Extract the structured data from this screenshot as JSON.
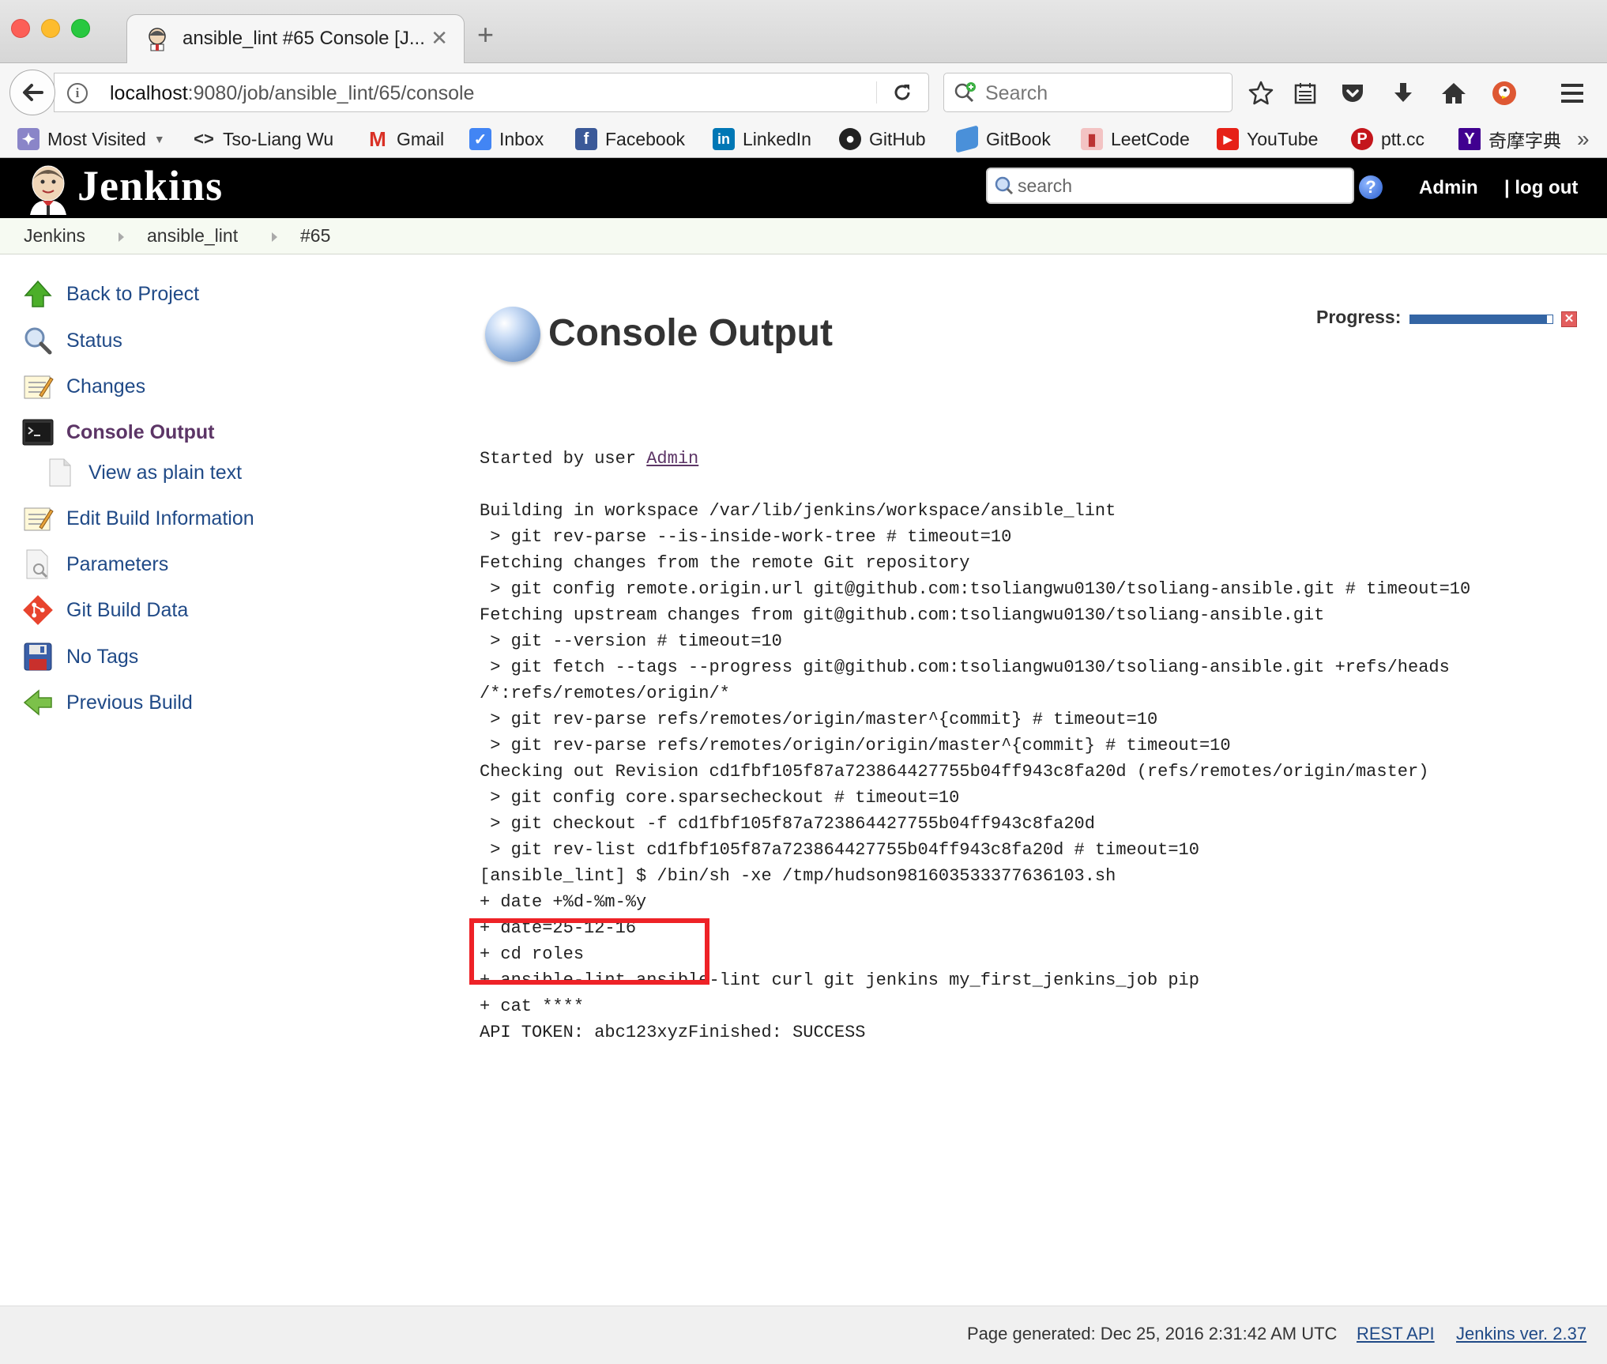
{
  "browser": {
    "tab_title": "ansible_lint #65 Console [J...",
    "new_tab": "+",
    "url_host": "localhost",
    "url_rest": ":9080/job/ansible_lint/65/console",
    "search_placeholder": "Search",
    "bookmarks": [
      {
        "label": "Most Visited",
        "icon": "most-visited-icon"
      },
      {
        "label": "Tso-Liang Wu",
        "icon": "code-icon"
      },
      {
        "label": "Gmail",
        "icon": "gmail-icon"
      },
      {
        "label": "Inbox",
        "icon": "inbox-icon"
      },
      {
        "label": "Facebook",
        "icon": "facebook-icon"
      },
      {
        "label": "LinkedIn",
        "icon": "linkedin-icon"
      },
      {
        "label": "GitHub",
        "icon": "github-icon"
      },
      {
        "label": "GitBook",
        "icon": "gitbook-icon"
      },
      {
        "label": "LeetCode",
        "icon": "leetcode-icon"
      },
      {
        "label": "YouTube",
        "icon": "youtube-icon"
      },
      {
        "label": "ptt.cc",
        "icon": "ptt-icon"
      },
      {
        "label": "奇摩字典",
        "icon": "yahoo-icon"
      }
    ],
    "more": "»"
  },
  "jenkins": {
    "logo": "Jenkins",
    "search_placeholder": "search",
    "help": "?",
    "user": "Admin",
    "logout": "log out"
  },
  "breadcrumb": [
    "Jenkins",
    "ansible_lint",
    "#65"
  ],
  "sidebar": {
    "items": [
      {
        "label": "Back to Project",
        "icon": "up-arrow-icon"
      },
      {
        "label": "Status",
        "icon": "magnifier-icon"
      },
      {
        "label": "Changes",
        "icon": "notepad-icon"
      },
      {
        "label": "Console Output",
        "icon": "terminal-icon"
      },
      {
        "label": "View as plain text",
        "icon": "document-icon"
      },
      {
        "label": "Edit Build Information",
        "icon": "notepad-icon"
      },
      {
        "label": "Parameters",
        "icon": "document-search-icon"
      },
      {
        "label": "Git Build Data",
        "icon": "git-icon"
      },
      {
        "label": "No Tags",
        "icon": "floppy-icon"
      },
      {
        "label": "Previous Build",
        "icon": "left-arrow-icon"
      }
    ]
  },
  "main": {
    "title": "Console Output",
    "progress_label": "Progress:",
    "progress_value": 0.96,
    "console_first_prefix": "Started by user ",
    "console_first_link": "Admin",
    "console_lines": [
      "Building in workspace /var/lib/jenkins/workspace/ansible_lint",
      " > git rev-parse --is-inside-work-tree # timeout=10",
      "Fetching changes from the remote Git repository",
      " > git config remote.origin.url git@github.com:tsoliangwu0130/tsoliang-ansible.git # timeout=10",
      "Fetching upstream changes from git@github.com:tsoliangwu0130/tsoliang-ansible.git",
      " > git --version # timeout=10",
      " > git fetch --tags --progress git@github.com:tsoliangwu0130/tsoliang-ansible.git +refs/heads",
      "/*:refs/remotes/origin/*",
      " > git rev-parse refs/remotes/origin/master^{commit} # timeout=10",
      " > git rev-parse refs/remotes/origin/origin/master^{commit} # timeout=10",
      "Checking out Revision cd1fbf105f87a723864427755b04ff943c8fa20d (refs/remotes/origin/master)",
      " > git config core.sparsecheckout # timeout=10",
      " > git checkout -f cd1fbf105f87a723864427755b04ff943c8fa20d",
      " > git rev-list cd1fbf105f87a723864427755b04ff943c8fa20d # timeout=10",
      "[ansible_lint] $ /bin/sh -xe /tmp/hudson981603533377636103.sh",
      "+ date +%d-%m-%y",
      "+ date=25-12-16",
      "+ cd roles",
      "+ ansible-lint ansible-lint curl git jenkins my_first_jenkins_job pip",
      "+ cat ****",
      "API TOKEN: abc123xyzFinished: SUCCESS"
    ]
  },
  "footer": {
    "generated": "Page generated: Dec 25, 2016 2:31:42 AM UTC",
    "rest_api": "REST API",
    "version": "Jenkins ver. 2.37"
  },
  "colors": {
    "link": "#204a87",
    "visited": "#5c3566",
    "header_bg": "#000000",
    "highlight": "#ee2227"
  }
}
